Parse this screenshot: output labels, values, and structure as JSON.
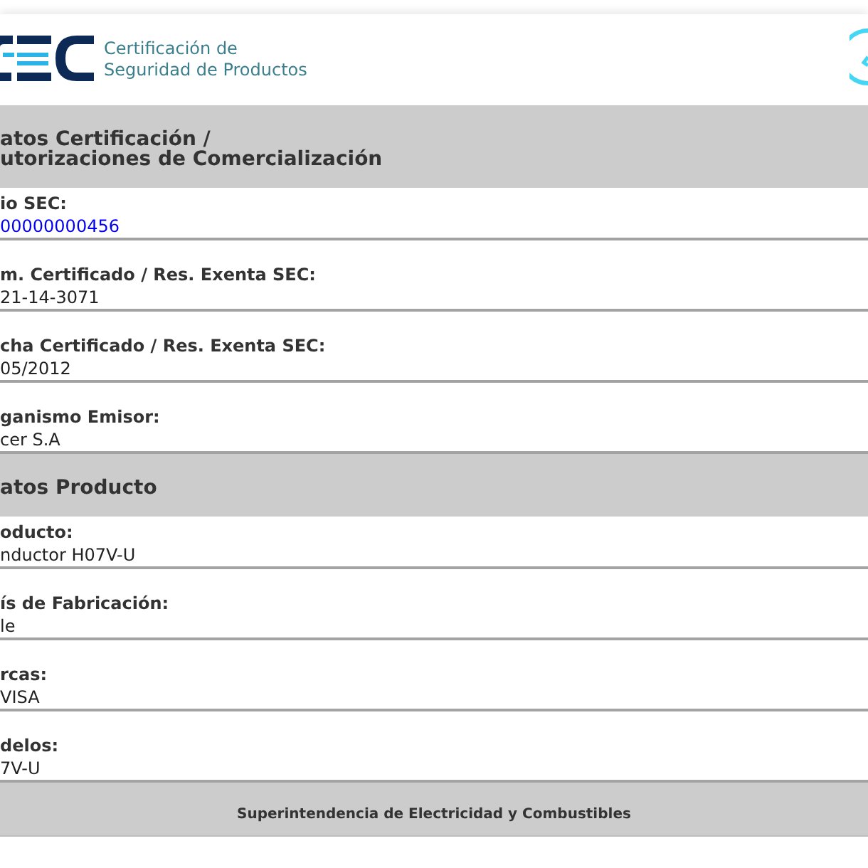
{
  "header": {
    "brand_lines": [
      "Certificación de",
      "Seguridad de Productos"
    ]
  },
  "sections": [
    {
      "title_lines": [
        "atos Certificación /",
        "utorizaciones de Comercialización"
      ],
      "fields": [
        {
          "label": "io SEC:",
          "value": "00000000456",
          "kind": "link"
        },
        {
          "label": "m. Certificado / Res. Exenta SEC:",
          "value": "21-14-3071",
          "kind": "text"
        },
        {
          "label": "cha Certificado / Res. Exenta SEC:",
          "value": "05/2012",
          "kind": "text"
        },
        {
          "label": "ganismo Emisor:",
          "value": "cer S.A",
          "kind": "text"
        }
      ]
    },
    {
      "title_lines": [
        "atos Producto"
      ],
      "fields": [
        {
          "label": "oducto:",
          "value": "nductor H07V-U",
          "kind": "text"
        },
        {
          "label": "ís de Fabricación:",
          "value": "le",
          "kind": "text"
        },
        {
          "label": "rcas:",
          "value": "VISA",
          "kind": "text"
        },
        {
          "label": "delos:",
          "value": "7V-U",
          "kind": "text"
        }
      ]
    }
  ],
  "footer": {
    "text": "Superintendencia de Electricidad y Combustibles"
  }
}
